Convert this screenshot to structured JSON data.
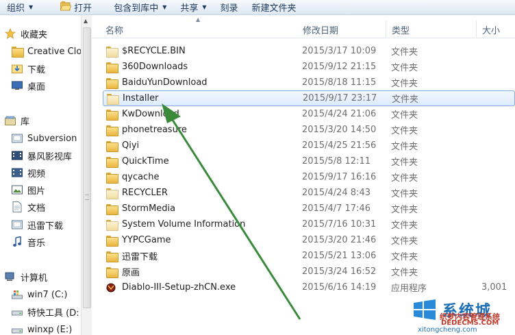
{
  "toolbar": {
    "organize": "组织",
    "open": "打开",
    "include_library": "包含到库中",
    "share": "共享",
    "burn": "刻录",
    "new_folder": "新建文件夹"
  },
  "nav": {
    "favorites": "收藏夹",
    "fav_items": [
      "Creative Clo",
      "下载",
      "桌面"
    ],
    "libraries": "库",
    "lib_items": [
      "Subversion",
      "暴风影视库",
      "视频",
      "图片",
      "文档",
      "迅雷下载",
      "音乐"
    ],
    "computer": "计算机",
    "drives": [
      "win7 (C:)",
      "特快工具 (D:",
      "winxp (E:)"
    ]
  },
  "columns": {
    "name": "名称",
    "date": "修改日期",
    "type": "类型",
    "size": "大小"
  },
  "files": [
    {
      "name": "$RECYCLE.BIN",
      "date": "2015/3/17 10:09",
      "type": "文件夹",
      "size": ""
    },
    {
      "name": "360Downloads",
      "date": "2015/9/12 21:15",
      "type": "文件夹",
      "size": ""
    },
    {
      "name": "BaiduYunDownload",
      "date": "2015/8/18 11:15",
      "type": "文件夹",
      "size": ""
    },
    {
      "name": "Installer",
      "date": "2015/9/17 23:17",
      "type": "文件夹",
      "size": ""
    },
    {
      "name": "KwDownload",
      "date": "2015/4/24 21:06",
      "type": "文件夹",
      "size": ""
    },
    {
      "name": "phonetreasure",
      "date": "2015/3/20 14:50",
      "type": "文件夹",
      "size": ""
    },
    {
      "name": "Qiyi",
      "date": "2015/4/25 21:56",
      "type": "文件夹",
      "size": ""
    },
    {
      "name": "QuickTime",
      "date": "2015/5/8 12:11",
      "type": "文件夹",
      "size": ""
    },
    {
      "name": "qycache",
      "date": "2015/9/17 16:16",
      "type": "文件夹",
      "size": ""
    },
    {
      "name": "RECYCLER",
      "date": "2015/4/24 8:43",
      "type": "文件夹",
      "size": ""
    },
    {
      "name": "StormMedia",
      "date": "2015/4/7 17:46",
      "type": "文件夹",
      "size": ""
    },
    {
      "name": "System Volume Information",
      "date": "2015/7/16 10:31",
      "type": "文件夹",
      "size": ""
    },
    {
      "name": "YYPCGame",
      "date": "2015/3/20 21:46",
      "type": "文件夹",
      "size": ""
    },
    {
      "name": "迅雷下载",
      "date": "2015/5/21 13:06",
      "type": "文件夹",
      "size": ""
    },
    {
      "name": "原画",
      "date": "2015/3/24 16:52",
      "type": "文件夹",
      "size": ""
    },
    {
      "name": "Diablo-III-Setup-zhCN.exe",
      "date": "2015/6/16 14:19",
      "type": "应用程序",
      "size": "3,001"
    }
  ],
  "watermark": {
    "brand": "系统城",
    "site1": "织梦内容管理系统",
    "site2": "DEDECMS.COM",
    "site3": "xitongcheng.com"
  },
  "colors": {
    "selection": "#dcebfb",
    "arrow": "#3a8a3a",
    "header_text": "#4c607a"
  }
}
